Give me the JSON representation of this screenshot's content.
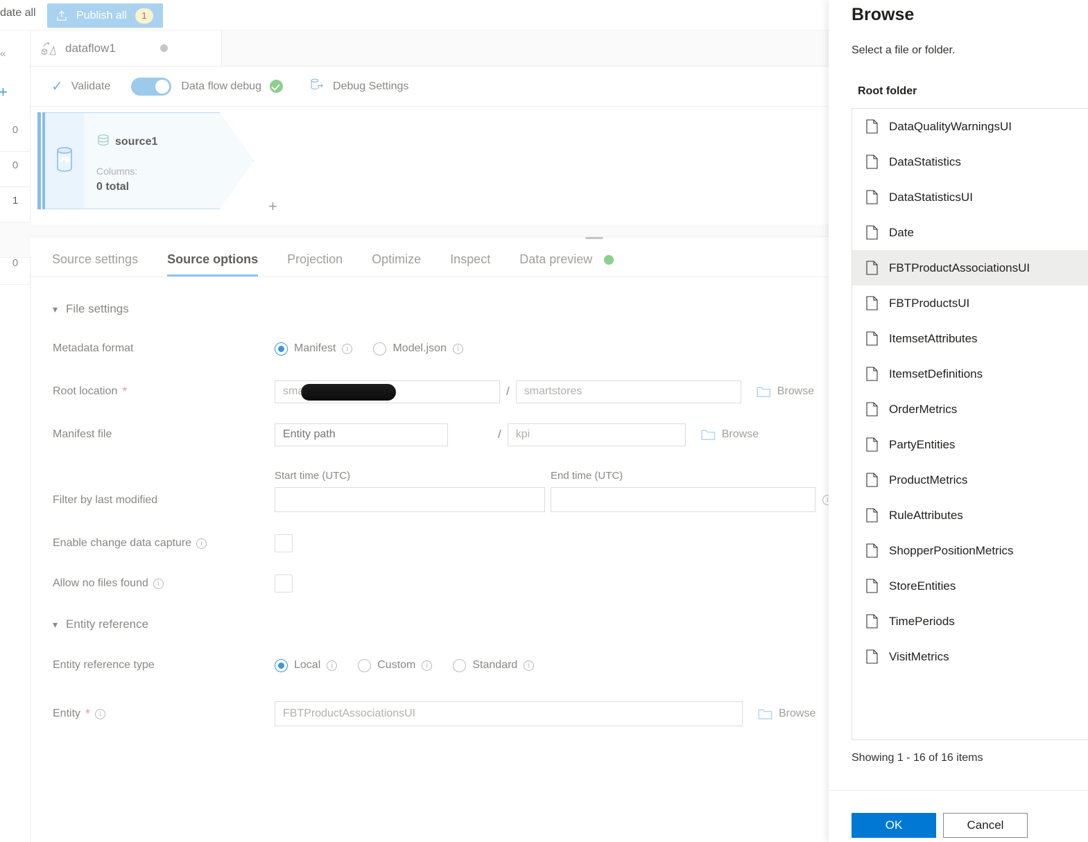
{
  "left_rail": {
    "collapse_icon": "chevron-double-left-icon",
    "add_icon": "plus-icon",
    "counts": [
      "0",
      "0",
      "1",
      "",
      "0"
    ]
  },
  "topbar": {
    "validate_all_label": "date all",
    "publish_all_label": "Publish all",
    "publish_all_badge": "1",
    "publish_icon": "upload-icon"
  },
  "dataflow_tab": {
    "label": "dataflow1",
    "icon": "dataflow-icon",
    "status_dot": "unsaved-dot"
  },
  "debug_bar": {
    "validate_label": "Validate",
    "validate_icon": "check-icon",
    "data_flow_debug_label": "Data flow debug",
    "toggle_on": true,
    "status_icon": "green-check-icon",
    "debug_settings_label": "Debug Settings",
    "debug_settings_icon": "database-export-icon"
  },
  "graph": {
    "node": {
      "name": "source1",
      "name_icon": "source-stream-icon",
      "side_icon": "source-database-icon",
      "columns_label": "Columns:",
      "columns_value": "0 total",
      "add_icon": "plus-icon"
    }
  },
  "tabs": [
    {
      "label": "Source settings",
      "active": false
    },
    {
      "label": "Source options",
      "active": true
    },
    {
      "label": "Projection",
      "active": false
    },
    {
      "label": "Optimize",
      "active": false
    },
    {
      "label": "Inspect",
      "active": false
    },
    {
      "label": "Data preview",
      "active": false,
      "dot": "green-status-dot"
    }
  ],
  "form": {
    "file_settings": {
      "section_title": "File settings",
      "chevron": "chevron-down-icon"
    },
    "metadata_format": {
      "label": "Metadata format",
      "options": [
        {
          "label": "Manifest",
          "selected": true
        },
        {
          "label": "Model.json",
          "selected": false
        }
      ]
    },
    "root_location": {
      "label": "Root location",
      "required": true,
      "container_value": "smar",
      "container_redacted": true,
      "folder_value": "smartstores",
      "browse_label": "Browse"
    },
    "manifest_file": {
      "label": "Manifest file",
      "entity_path_placeholder": "Entity path",
      "manifest_name_value": "kpi",
      "browse_label": "Browse"
    },
    "filter_by_last_modified": {
      "label": "Filter by last modified",
      "start_time_label": "Start time (UTC)",
      "end_time_label": "End time (UTC)",
      "start_time_value": "",
      "end_time_value": ""
    },
    "enable_change_data_capture": {
      "label": "Enable change data capture",
      "checked": false
    },
    "allow_no_files_found": {
      "label": "Allow no files found",
      "checked": false
    },
    "entity_reference": {
      "section_title": "Entity reference",
      "chevron": "chevron-down-icon",
      "type_label": "Entity reference type",
      "type_options": [
        {
          "label": "Local",
          "selected": true
        },
        {
          "label": "Custom",
          "selected": false
        },
        {
          "label": "Standard",
          "selected": false
        }
      ],
      "entity_label": "Entity",
      "entity_required": true,
      "entity_value": "FBTProductAssociationsUI",
      "browse_label": "Browse"
    }
  },
  "browse_panel": {
    "title": "Browse",
    "subtitle": "Select a file or folder.",
    "field_label": "Root folder",
    "items": [
      {
        "name": "DataQualityWarningsUI",
        "selected": false
      },
      {
        "name": "DataStatistics",
        "selected": false
      },
      {
        "name": "DataStatisticsUI",
        "selected": false
      },
      {
        "name": "Date",
        "selected": false
      },
      {
        "name": "FBTProductAssociationsUI",
        "selected": true
      },
      {
        "name": "FBTProductsUI",
        "selected": false
      },
      {
        "name": "ItemsetAttributes",
        "selected": false
      },
      {
        "name": "ItemsetDefinitions",
        "selected": false
      },
      {
        "name": "OrderMetrics",
        "selected": false
      },
      {
        "name": "PartyEntities",
        "selected": false
      },
      {
        "name": "ProductMetrics",
        "selected": false
      },
      {
        "name": "RuleAttributes",
        "selected": false
      },
      {
        "name": "ShopperPositionMetrics",
        "selected": false
      },
      {
        "name": "StoreEntities",
        "selected": false
      },
      {
        "name": "TimePeriods",
        "selected": false
      },
      {
        "name": "VisitMetrics",
        "selected": false
      }
    ],
    "showing_text": "Showing 1 - 16 of 16 items",
    "ok_label": "OK",
    "cancel_label": "Cancel"
  },
  "colors": {
    "accent_blue": "#0078d4",
    "publish_blue": "#a9d2f0",
    "toggle_blue": "#9ccaeb",
    "status_green": "#8ece8e",
    "required_red": "#e89a9a",
    "selected_row": "#ededeb"
  }
}
